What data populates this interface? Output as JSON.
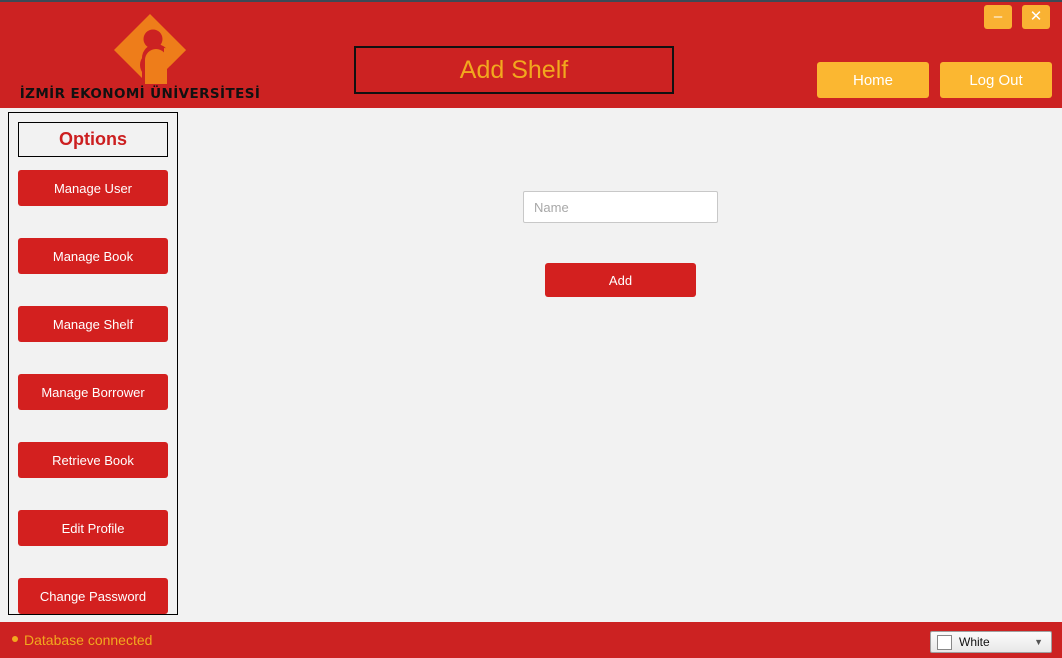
{
  "window": {
    "minimize_label": "–",
    "close_label": "✕"
  },
  "header": {
    "logo_text": "İZMİR EKONOMİ ÜNİVERSİTESİ",
    "logo_icon": "izmir-ekonomi-diamond-logo",
    "page_title": "Add Shelf",
    "nav": {
      "home_label": "Home",
      "logout_label": "Log Out"
    },
    "background_color": "#cc2222",
    "title_color": "#f2a81e",
    "nav_button_color": "#fbb731"
  },
  "sidebar": {
    "title": "Options",
    "title_color": "#cc1f20",
    "button_color": "#d3201f",
    "items": [
      {
        "label": "Manage User"
      },
      {
        "label": "Manage Book"
      },
      {
        "label": "Manage Shelf"
      },
      {
        "label": "Manage Borrower"
      },
      {
        "label": "Retrieve Book"
      },
      {
        "label": "Edit Profile"
      },
      {
        "label": "Change Password"
      }
    ]
  },
  "main": {
    "name_field": {
      "value": "",
      "placeholder": "Name"
    },
    "add_button_label": "Add",
    "background_color": "#f2f2f2"
  },
  "status_bar": {
    "database_status": "Database connected",
    "status_color": "#f2a81e",
    "theme": {
      "selected": "White",
      "swatch_color": "#ffffff",
      "chevron_icon": "▼"
    }
  }
}
